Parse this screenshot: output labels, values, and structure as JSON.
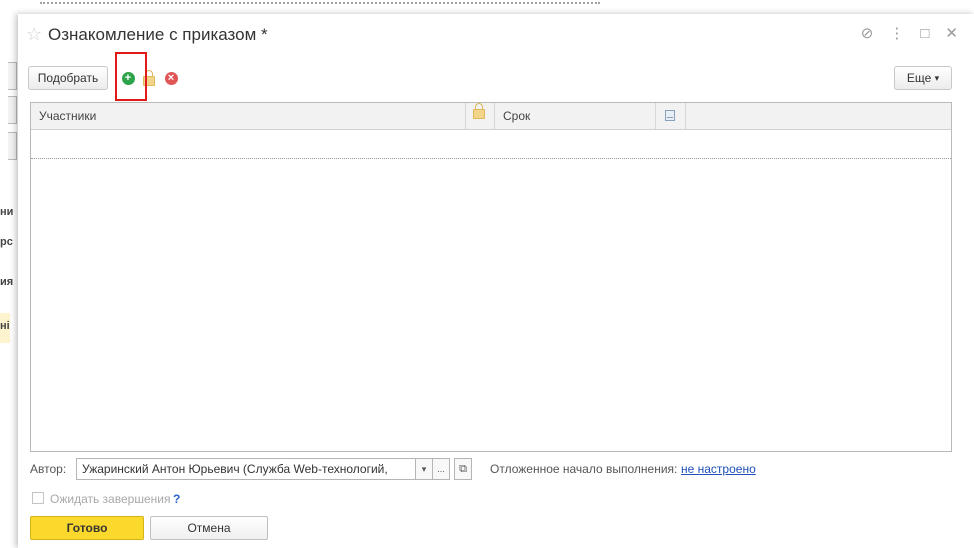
{
  "window": {
    "title": "Ознакомление с приказом *"
  },
  "titlebar_icons": [
    "star-icon",
    "link-icon",
    "more-icon",
    "maximize-icon",
    "close-icon"
  ],
  "titlebar_glyphs": {
    "star": "☆",
    "link": "⊘",
    "more": "⋮",
    "maximize": "□",
    "close": "✕"
  },
  "toolbar": {
    "pick_label": "Подобрать",
    "more_label": "Еще",
    "more_arrow": "▾",
    "add_glyph": "+",
    "remove_glyph": "×"
  },
  "table": {
    "columns": [
      "Участники",
      "Срок"
    ]
  },
  "footer": {
    "author_label": "Автор:",
    "author_value": "Ужаринский Антон Юрьевич (Служба Web-технологий,",
    "author_dropdown": "▾",
    "author_select": "...",
    "author_open": "⧉",
    "deferred_label": "Отложенное начало выполнения:",
    "deferred_link": "не настроено",
    "wait_label": "Ожидать завершения",
    "wait_help": "?"
  },
  "buttons": {
    "ok_label": "Готово",
    "cancel_label": "Отмена"
  },
  "colors": {
    "accent_ok": "#fbd92c",
    "add_green": "#2ea44a",
    "remove_red": "#e05656",
    "highlight_red": "#e01919",
    "link_blue": "#1f4fb8"
  },
  "background_fragments": [
    "ни",
    "рс",
    "ия",
    "ні"
  ]
}
